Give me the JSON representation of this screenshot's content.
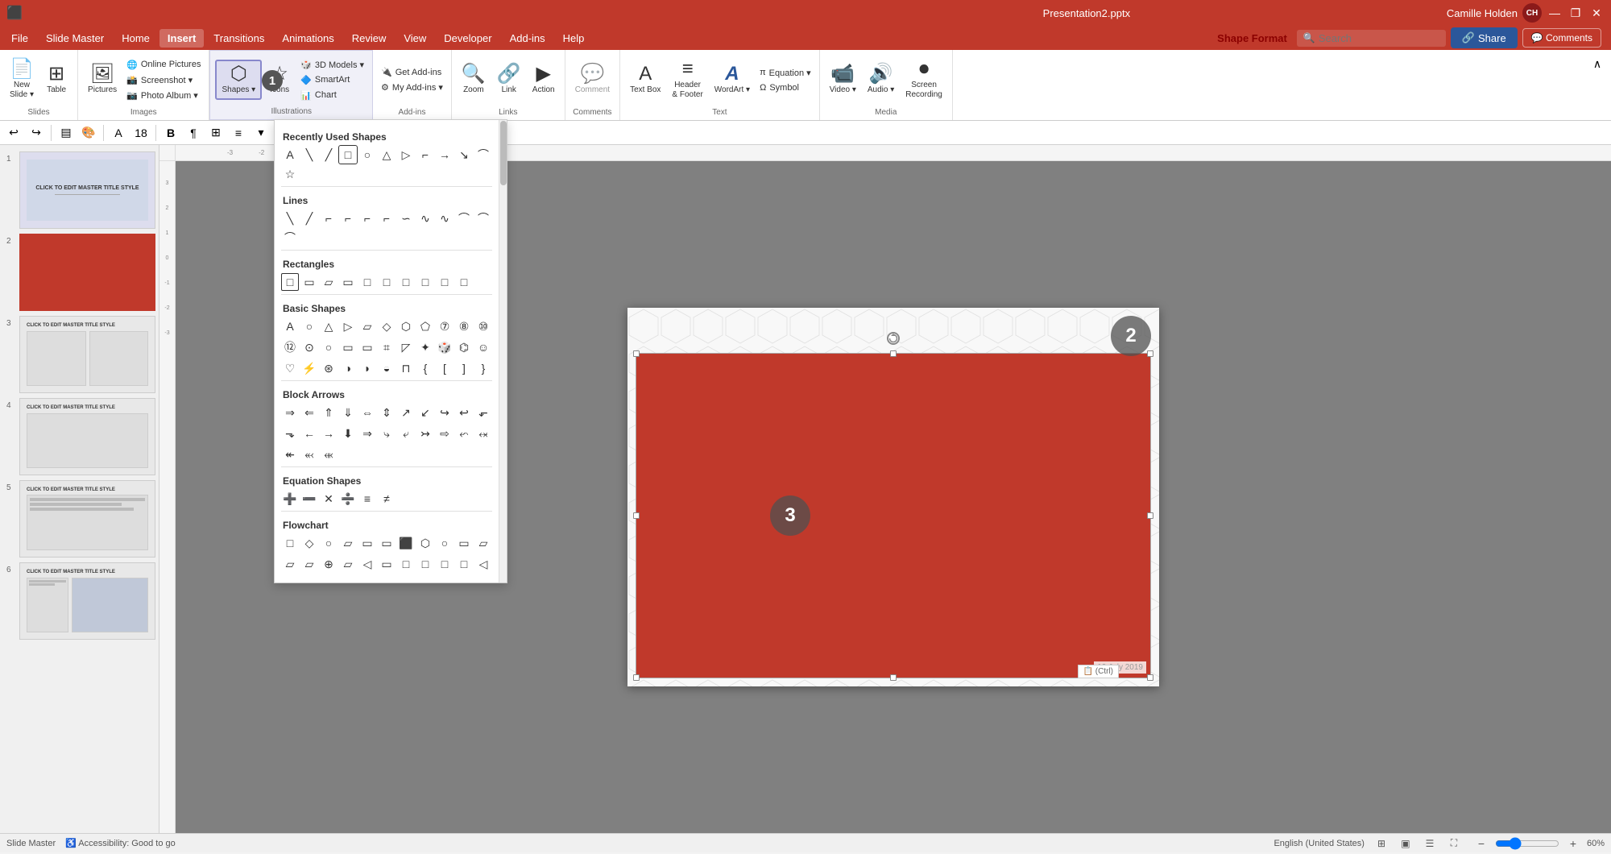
{
  "titlebar": {
    "title": "Presentation2.pptx",
    "user": "Camille Holden",
    "user_initials": "CH",
    "minimize": "—",
    "maximize": "❐",
    "close": "✕"
  },
  "menubar": {
    "items": [
      "File",
      "Slide Master",
      "Home",
      "Insert",
      "Transitions",
      "Animations",
      "Review",
      "View",
      "Developer",
      "Add-ins",
      "Help"
    ],
    "active": "Insert",
    "shape_format": "Shape Format"
  },
  "ribbon": {
    "groups": {
      "slides": {
        "label": "Slides",
        "new_slide": "New\nSlide",
        "table": "Table"
      },
      "images": {
        "label": "Images",
        "pictures": "Pictures",
        "online_pictures": "Online Pictures",
        "screenshot": "Screenshot",
        "photo_album": "Photo Album"
      },
      "illustrations": {
        "label": "Illustrations",
        "shapes": "Shapes",
        "icons": "Icons",
        "models_3d": "3D Models",
        "smartart": "SmartArt",
        "chart": "Chart"
      },
      "addins": {
        "label": "Add-ins",
        "get_addins": "Get Add-ins",
        "my_addins": "My Add-ins"
      },
      "links": {
        "label": "Links",
        "zoom": "Zoom",
        "link": "Link",
        "action": "Action"
      },
      "comments": {
        "label": "Comments",
        "comment": "Comment"
      },
      "text": {
        "label": "Text",
        "text_box": "Text Box",
        "header_footer": "Header\n& Footer",
        "wordart": "WordArt",
        "equation": "Equation",
        "symbol": "Symbol"
      },
      "media": {
        "label": "Media",
        "video": "Video",
        "audio": "Audio",
        "screen_recording": "Screen\nRecording"
      }
    },
    "search": {
      "placeholder": "Search",
      "label": "Search"
    },
    "share_btn": "Share",
    "comments_btn": "Comments"
  },
  "shapes_dropdown": {
    "title": "Recently Used Shapes",
    "sections": [
      {
        "name": "Recently Used Shapes",
        "shapes": [
          "A",
          "╲",
          "╱",
          "□",
          "○",
          "△",
          "▷",
          "⌐",
          "⌐",
          "→",
          "⌐",
          "↘"
        ]
      },
      {
        "name": "Lines",
        "shapes": [
          "╲",
          "╱",
          "⌐",
          "⌐",
          "⌐",
          "⌐",
          "∽",
          "∿",
          "∿",
          "⌒",
          "⌒",
          "⌒"
        ]
      },
      {
        "name": "Rectangles",
        "shapes": [
          "□",
          "▭",
          "▱",
          "▭",
          "□",
          "□",
          "□",
          "□",
          "□",
          "□"
        ]
      },
      {
        "name": "Basic Shapes",
        "shapes": [
          "A",
          "○",
          "△",
          "▷",
          "▱",
          "◇",
          "⬡",
          "⬠",
          "⑦",
          "⑧",
          "⑩",
          "⑫",
          "⊙",
          "○",
          "○",
          "▭",
          "▭",
          "▭",
          "◸",
          "✦",
          "▭",
          "▭",
          "▭",
          "□",
          "□",
          "□",
          "□",
          "☺",
          "♡",
          "⚡",
          "◎",
          "◑",
          "◗",
          "◒",
          "◑",
          "{}",
          "[]",
          "{}",
          "[",
          "]",
          "{",
          "}"
        ]
      },
      {
        "name": "Block Arrows",
        "shapes": [
          "→",
          "←",
          "↑",
          "↓",
          "⇔",
          "⇕",
          "↗",
          "↙",
          "↪",
          "↩",
          "⬐",
          "↪",
          "⬎",
          "←",
          "→",
          "⇓",
          "⇒",
          "⤷",
          "⤶",
          "↣",
          "⇒",
          "⇨",
          "⬿",
          "⬾",
          "↞",
          "⬻",
          "⬺",
          "↟",
          "↡",
          "↠"
        ]
      },
      {
        "name": "Equation Shapes",
        "shapes": [
          "➕",
          "➖",
          "✕",
          "➗",
          "≡",
          "≠"
        ]
      },
      {
        "name": "Flowchart",
        "shapes": [
          "□",
          "◇",
          "○",
          "▱",
          "▭",
          "▭",
          "▭",
          "⬡",
          "○",
          "▭",
          "▱",
          "▱",
          "▱",
          "⊕",
          "▱",
          "◁",
          "▭",
          "□",
          "□",
          "□",
          "□",
          "◁"
        ]
      }
    ]
  },
  "slide_panel": {
    "slides": [
      {
        "num": 1,
        "type": "title"
      },
      {
        "num": 2,
        "type": "red",
        "active": true
      },
      {
        "num": 3,
        "type": "layout"
      },
      {
        "num": 4,
        "type": "layout2"
      },
      {
        "num": 5,
        "type": "layout3"
      },
      {
        "num": 6,
        "type": "layout4"
      }
    ]
  },
  "canvas": {
    "badges": [
      {
        "id": "2",
        "label": "2",
        "style": "top-right"
      },
      {
        "id": "3",
        "label": "3",
        "style": "center"
      }
    ]
  },
  "statusbar": {
    "mode": "Slide Master",
    "lang": "English (United States)",
    "date": "19 July 2019",
    "zoom": "60%",
    "clipboard": "(Ctrl)"
  },
  "toolbar": {
    "font_size": "18"
  }
}
